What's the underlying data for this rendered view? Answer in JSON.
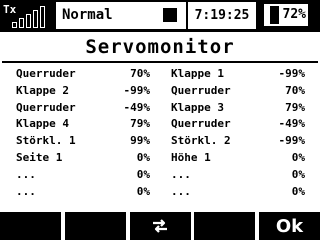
{
  "status": {
    "tx_label": "Tx",
    "signal_level": 4,
    "signal_max": 5,
    "mode": "Normal",
    "time": "7:19:25",
    "battery_percent": 72,
    "battery_label": "72%"
  },
  "title": "Servomonitor",
  "servos": [
    {
      "left": {
        "name": "Querruder",
        "value": "70%"
      },
      "right": {
        "name": "Klappe 1",
        "value": "-99%"
      }
    },
    {
      "left": {
        "name": "Klappe 2",
        "value": "-99%"
      },
      "right": {
        "name": "Querruder",
        "value": "70%"
      }
    },
    {
      "left": {
        "name": "Querruder",
        "value": "-49%"
      },
      "right": {
        "name": "Klappe 3",
        "value": "79%"
      }
    },
    {
      "left": {
        "name": "Klappe 4",
        "value": "79%"
      },
      "right": {
        "name": "Querruder",
        "value": "-49%"
      }
    },
    {
      "left": {
        "name": "Störkl. 1",
        "value": "99%"
      },
      "right": {
        "name": "Störkl. 2",
        "value": "-99%"
      }
    },
    {
      "left": {
        "name": "Seite 1",
        "value": "0%"
      },
      "right": {
        "name": "Höhe 1",
        "value": "0%"
      }
    },
    {
      "left": {
        "name": "...",
        "value": "0%"
      },
      "right": {
        "name": "...",
        "value": "0%"
      }
    },
    {
      "left": {
        "name": "...",
        "value": "0%"
      },
      "right": {
        "name": "...",
        "value": "0%"
      }
    }
  ],
  "softkeys": [
    {
      "label": ""
    },
    {
      "label": ""
    },
    {
      "label": "",
      "icon": "swap-arrows-icon"
    },
    {
      "label": ""
    },
    {
      "label": "Ok"
    }
  ]
}
